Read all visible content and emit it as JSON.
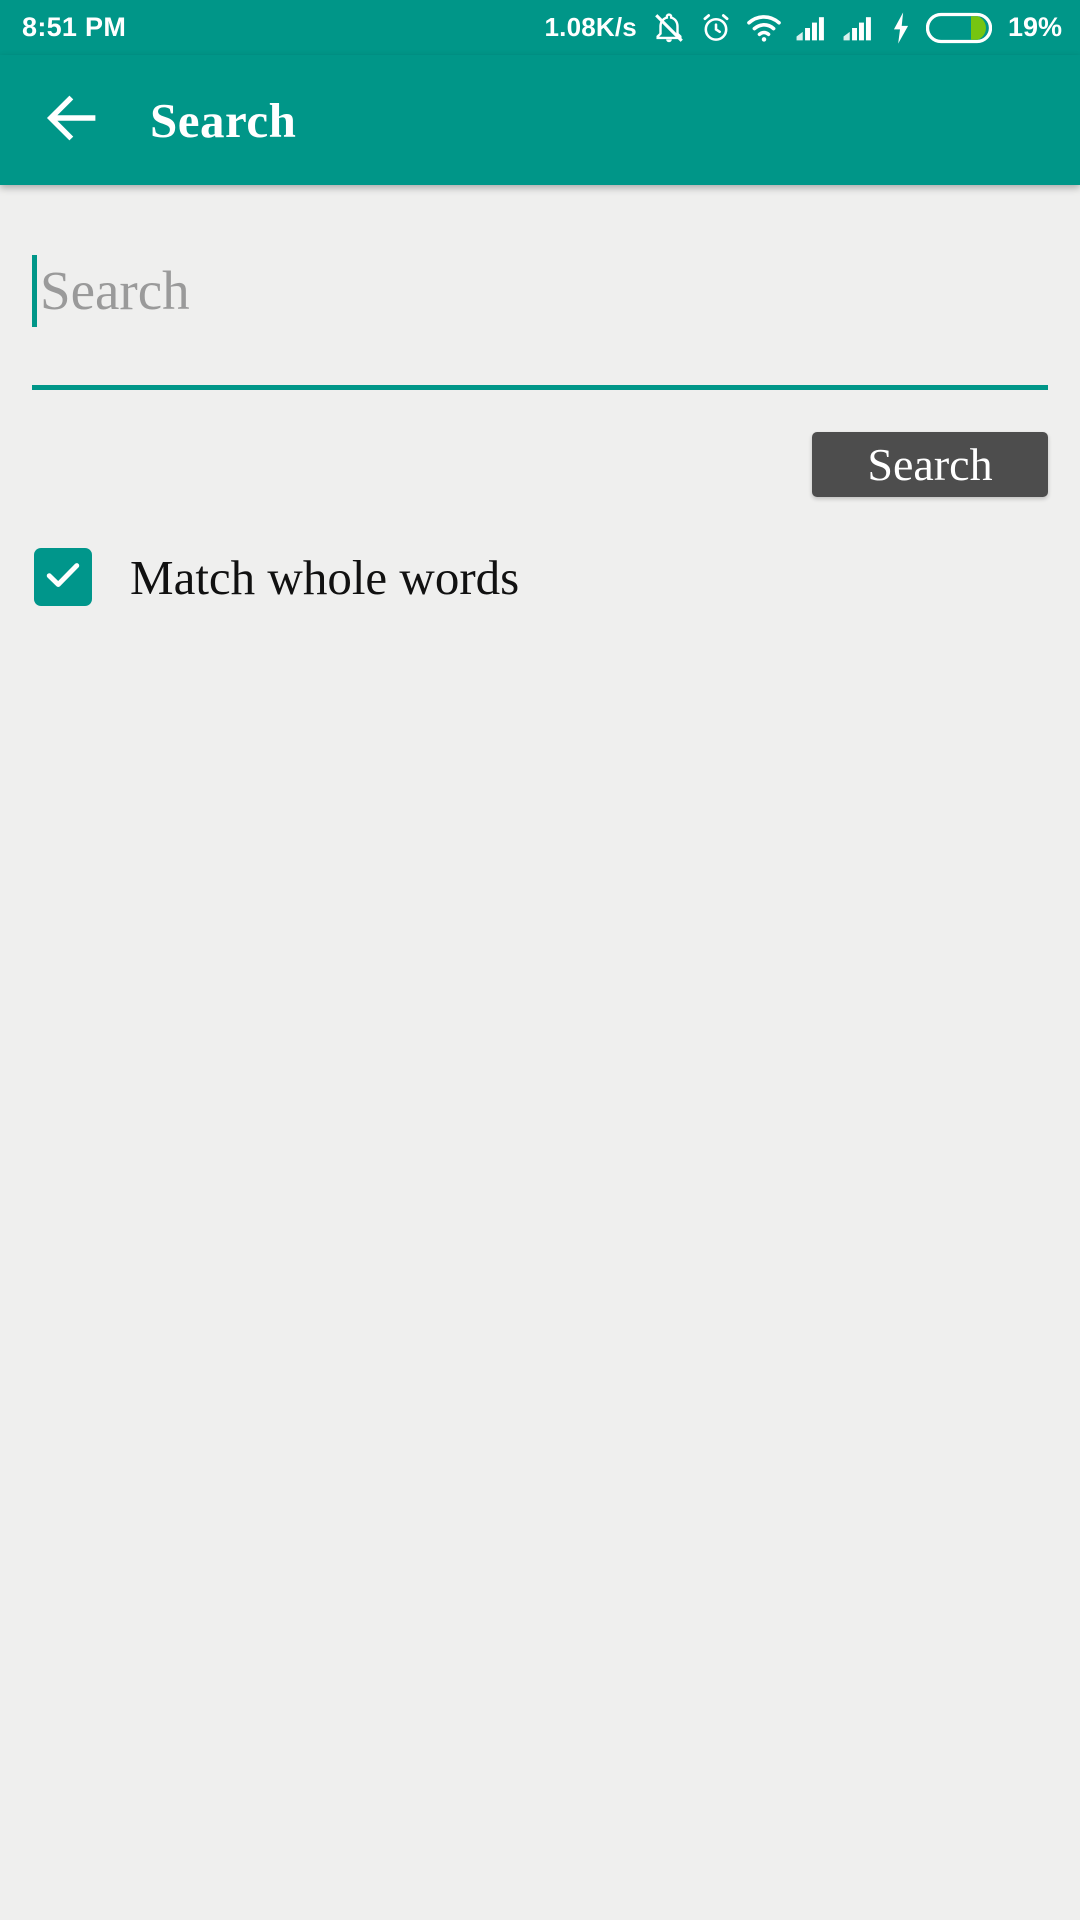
{
  "status_bar": {
    "time": "8:51 PM",
    "network_speed": "1.08K/s",
    "battery_percent": "19%",
    "icons": [
      "bell-muted-icon",
      "alarm-clock-icon",
      "wifi-icon",
      "signal-bars-1-icon",
      "signal-bars-2-icon",
      "charging-bolt-icon",
      "battery-icon"
    ],
    "colors": {
      "background": "#009688",
      "foreground": "#ffffff",
      "battery_fill": "#76c511"
    }
  },
  "app_bar": {
    "title": "Search",
    "back_icon": "arrow-left-icon",
    "background": "#009688",
    "text_color": "#ffffff"
  },
  "main": {
    "search_input": {
      "value": "",
      "placeholder": "Search",
      "underline_color": "#009688",
      "caret_color": "#009688",
      "placeholder_color": "#9a9a9a"
    },
    "search_button": {
      "label": "Search",
      "background": "#4d4d4d",
      "text_color": "#ffffff"
    },
    "match_whole_words": {
      "label": "Match whole words",
      "checked": true,
      "checkbox_color": "#00968b",
      "check_color": "#ffffff"
    },
    "background": "#efefee"
  }
}
